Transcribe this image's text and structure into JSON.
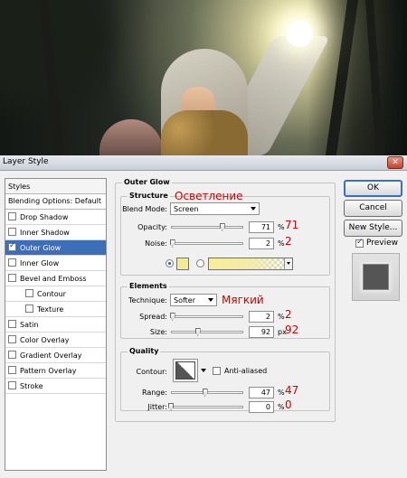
{
  "window": {
    "title": "Layer Style"
  },
  "styles_list": {
    "header": "Styles",
    "blending_options": "Blending Options: Default",
    "items": [
      {
        "label": "Drop Shadow",
        "checked": false,
        "selected": false,
        "indent": false
      },
      {
        "label": "Inner Shadow",
        "checked": false,
        "selected": false,
        "indent": false
      },
      {
        "label": "Outer Glow",
        "checked": true,
        "selected": true,
        "indent": false
      },
      {
        "label": "Inner Glow",
        "checked": false,
        "selected": false,
        "indent": false
      },
      {
        "label": "Bevel and Emboss",
        "checked": false,
        "selected": false,
        "indent": false
      },
      {
        "label": "Contour",
        "checked": false,
        "selected": false,
        "indent": true
      },
      {
        "label": "Texture",
        "checked": false,
        "selected": false,
        "indent": true
      },
      {
        "label": "Satin",
        "checked": false,
        "selected": false,
        "indent": false
      },
      {
        "label": "Color Overlay",
        "checked": false,
        "selected": false,
        "indent": false
      },
      {
        "label": "Gradient Overlay",
        "checked": false,
        "selected": false,
        "indent": false
      },
      {
        "label": "Pattern Overlay",
        "checked": false,
        "selected": false,
        "indent": false
      },
      {
        "label": "Stroke",
        "checked": false,
        "selected": false,
        "indent": false
      }
    ]
  },
  "panel": {
    "title": "Outer Glow",
    "structure": {
      "title": "Structure",
      "blend_mode_label": "Blend Mode:",
      "blend_mode_value": "Screen",
      "opacity_label": "Opacity:",
      "opacity_value": "71",
      "opacity_fraction": 0.71,
      "noise_label": "Noise:",
      "noise_value": "2",
      "noise_fraction": 0.02,
      "unit": "%",
      "glow_color": "#f3e99a"
    },
    "elements": {
      "title": "Elements",
      "technique_label": "Technique:",
      "technique_value": "Softer",
      "spread_label": "Spread:",
      "spread_value": "2",
      "spread_fraction": 0.02,
      "size_label": "Size:",
      "size_value": "92",
      "size_fraction": 0.37,
      "spread_unit": "%",
      "size_unit": "px"
    },
    "quality": {
      "title": "Quality",
      "contour_label": "Contour:",
      "anti_aliased_label": "Anti-aliased",
      "range_label": "Range:",
      "range_value": "47",
      "range_fraction": 0.47,
      "jitter_label": "Jitter:",
      "jitter_value": "0",
      "jitter_fraction": 0.0,
      "unit": "%"
    }
  },
  "annotations": {
    "blend": "Осветление",
    "opacity": "71",
    "noise": "2",
    "technique": "Мягкий",
    "spread": "2",
    "size": "92",
    "range": "47",
    "jitter": "0"
  },
  "buttons": {
    "ok": "OK",
    "cancel": "Cancel",
    "new_style": "New Style...",
    "preview_label": "Preview",
    "preview_checked": true
  }
}
